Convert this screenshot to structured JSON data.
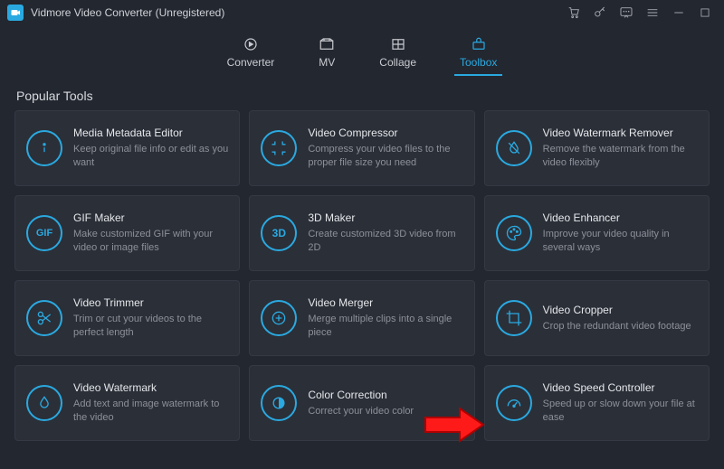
{
  "window": {
    "title": "Vidmore Video Converter (Unregistered)"
  },
  "tabs": {
    "converter": "Converter",
    "mv": "MV",
    "collage": "Collage",
    "toolbox": "Toolbox"
  },
  "section_title": "Popular Tools",
  "tools": [
    {
      "title": "Media Metadata Editor",
      "desc": "Keep original file info or edit as you want"
    },
    {
      "title": "Video Compressor",
      "desc": "Compress your video files to the proper file size you need"
    },
    {
      "title": "Video Watermark Remover",
      "desc": "Remove the watermark from the video flexibly"
    },
    {
      "title": "GIF Maker",
      "desc": "Make customized GIF with your video or image files"
    },
    {
      "title": "3D Maker",
      "desc": "Create customized 3D video from 2D"
    },
    {
      "title": "Video Enhancer",
      "desc": "Improve your video quality in several ways"
    },
    {
      "title": "Video Trimmer",
      "desc": "Trim or cut your videos to the perfect length"
    },
    {
      "title": "Video Merger",
      "desc": "Merge multiple clips into a single piece"
    },
    {
      "title": "Video Cropper",
      "desc": "Crop the redundant video footage"
    },
    {
      "title": "Video Watermark",
      "desc": "Add text and image watermark to the video"
    },
    {
      "title": "Color Correction",
      "desc": "Correct your video color"
    },
    {
      "title": "Video Speed Controller",
      "desc": "Speed up or slow down your file at ease"
    }
  ]
}
